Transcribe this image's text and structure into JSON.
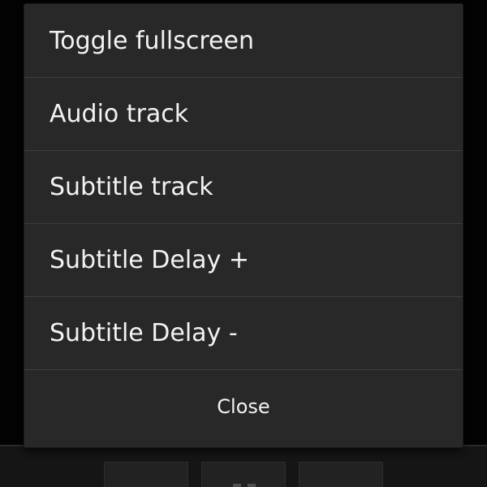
{
  "menu": {
    "items": [
      {
        "label": "Toggle fullscreen"
      },
      {
        "label": "Audio track"
      },
      {
        "label": "Subtitle track"
      },
      {
        "label": "Subtitle Delay +"
      },
      {
        "label": "Subtitle Delay -"
      }
    ],
    "close_label": "Close"
  },
  "controls": {
    "icons": [
      "previous-icon",
      "pause-icon",
      "next-icon"
    ]
  },
  "colors": {
    "menu_background": "#282828",
    "divider": "#3e3e3e",
    "text": "#f2f2f2",
    "screen_background": "#050505"
  }
}
